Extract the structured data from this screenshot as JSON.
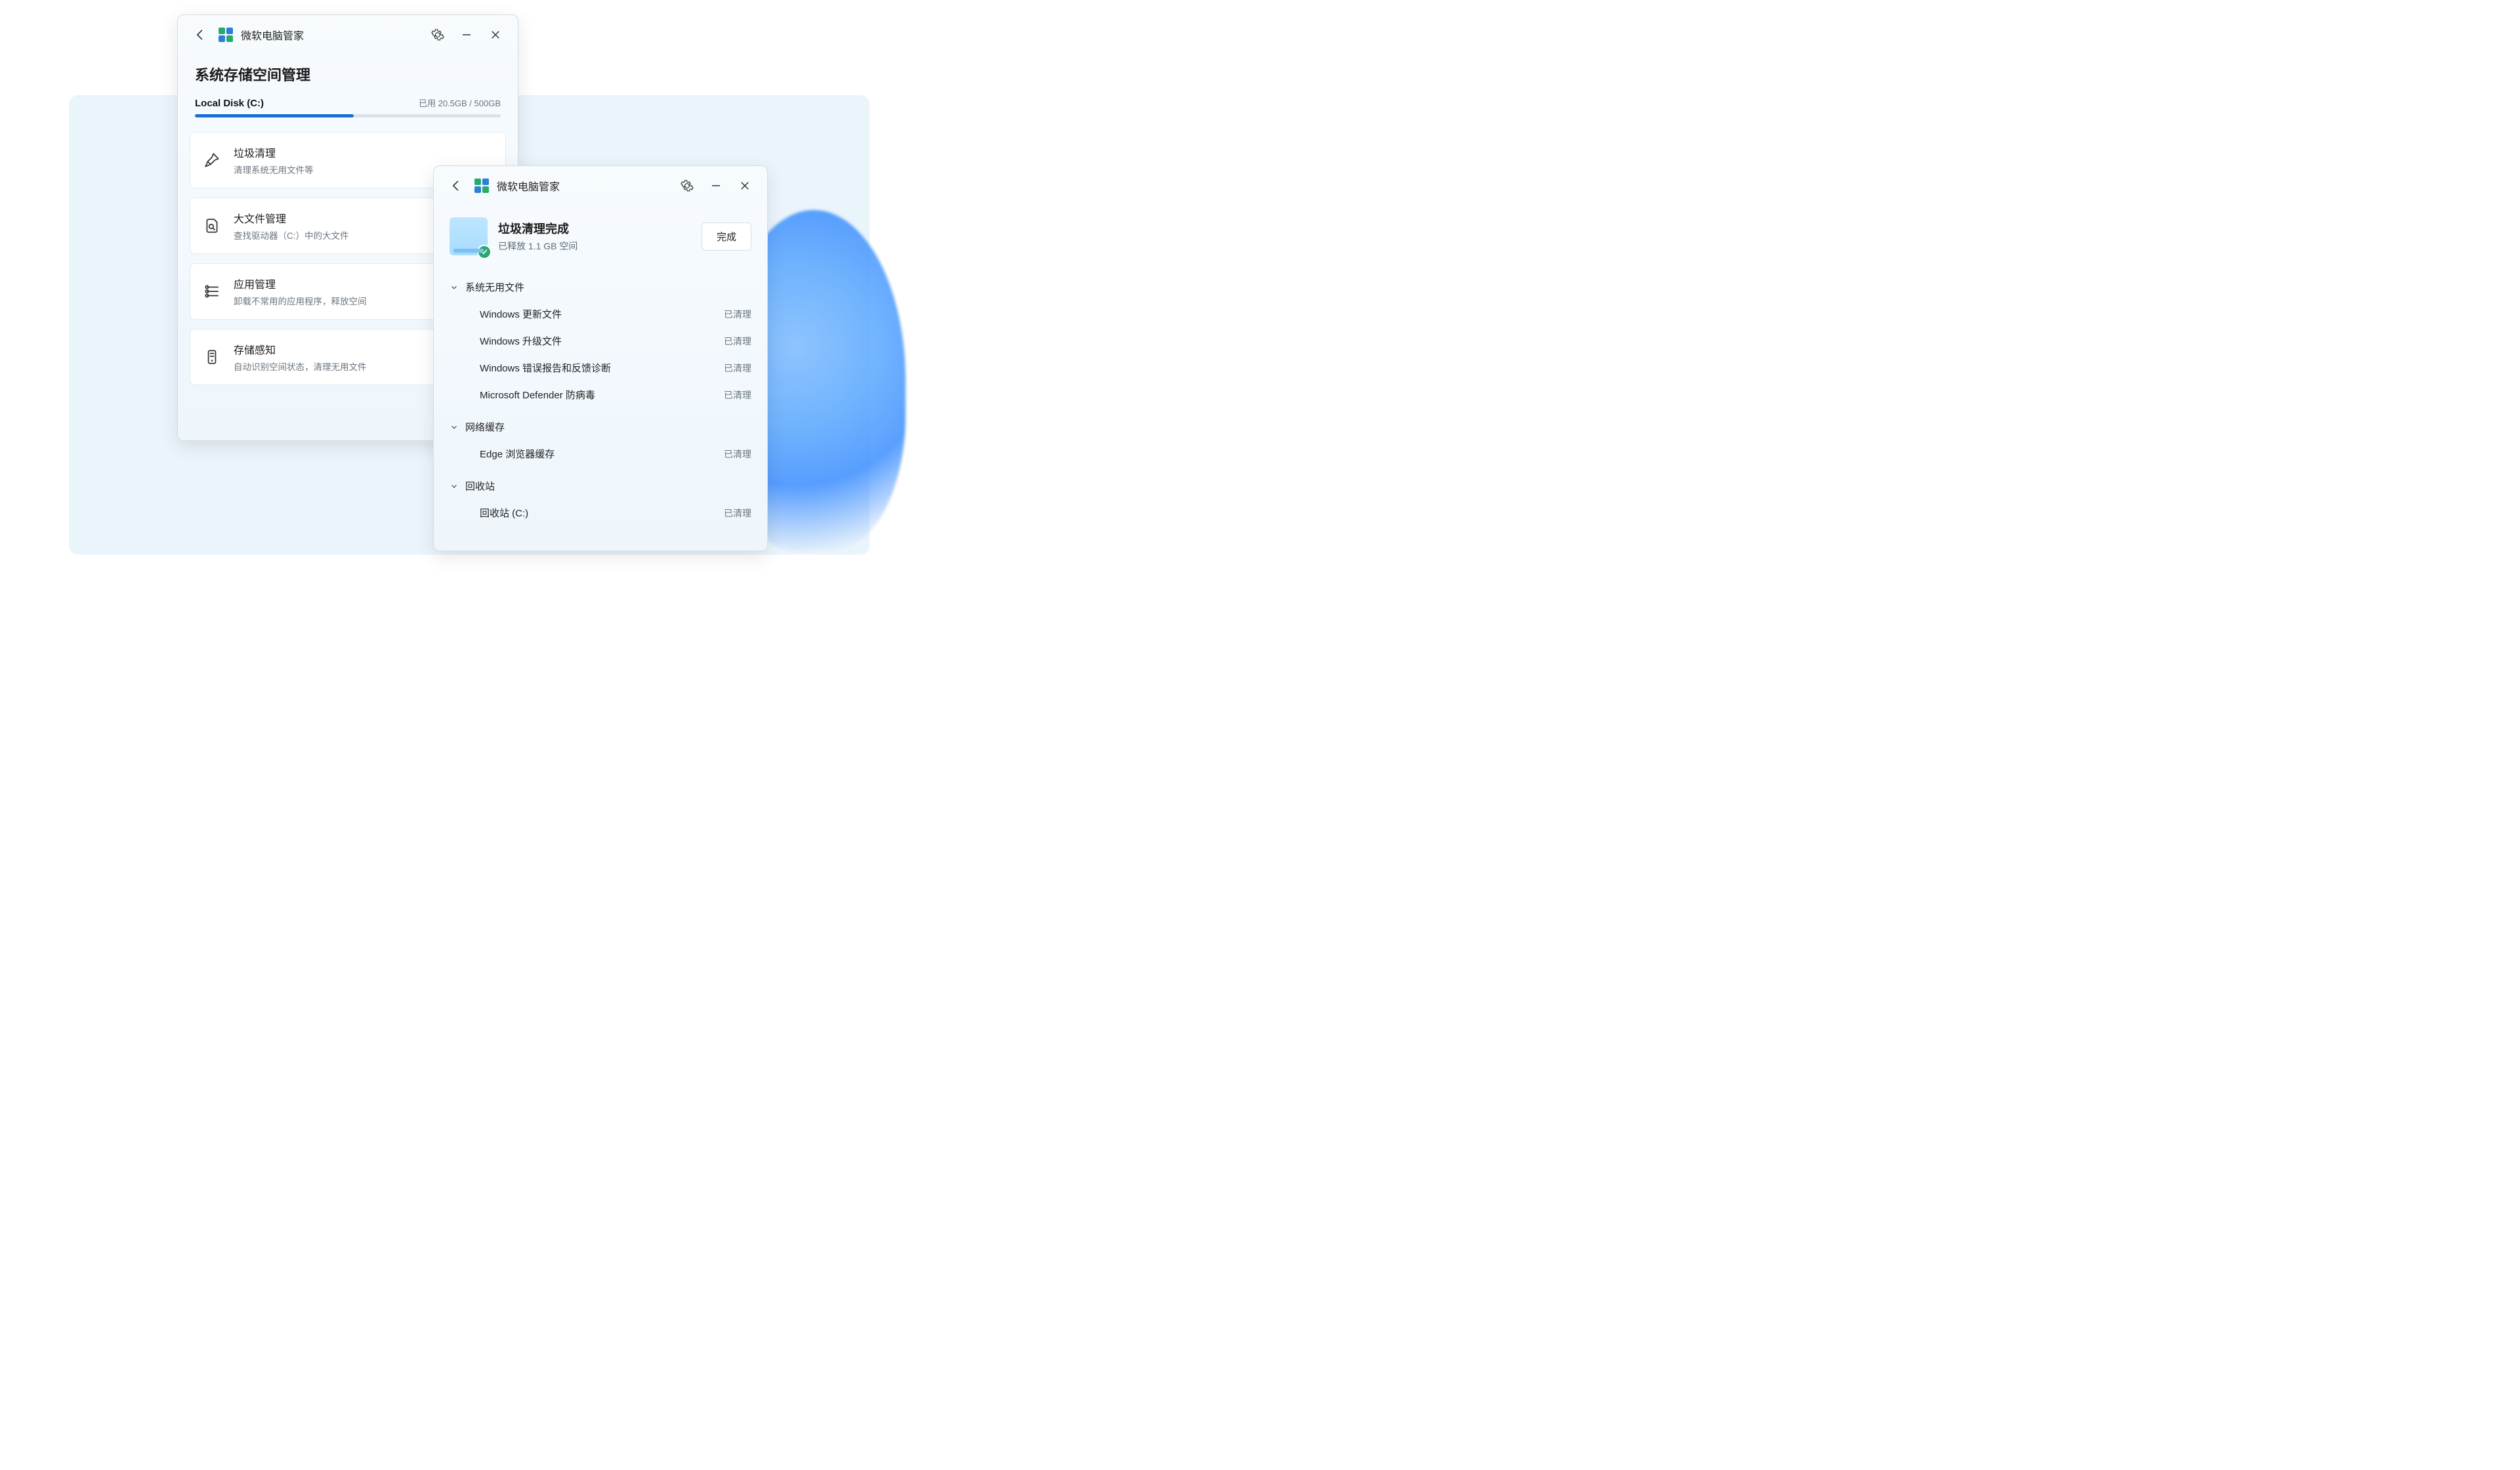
{
  "app_title": "微软电脑管家",
  "windowA": {
    "page_title": "系统存储空间管理",
    "disk_name": "Local Disk (C:)",
    "disk_usage": "已用 20.5GB / 500GB",
    "cards": [
      {
        "title": "垃圾清理",
        "sub": "清理系统无用文件等"
      },
      {
        "title": "大文件管理",
        "sub": "查找驱动器（C:）中的大文件"
      },
      {
        "title": "应用管理",
        "sub": "卸载不常用的应用程序，释放空间"
      },
      {
        "title": "存储感知",
        "sub": "自动识别空间状态，清理无用文件"
      }
    ]
  },
  "windowB": {
    "result_title": "垃圾清理完成",
    "result_sub": "已释放 1.1 GB 空间",
    "done_label": "完成",
    "status_cleaned": "已清理",
    "groups": [
      {
        "name": "系统无用文件",
        "items": [
          "Windows 更新文件",
          "Windows 升级文件",
          "Windows 错误报告和反馈诊断",
          "Microsoft Defender 防病毒"
        ]
      },
      {
        "name": "网络缓存",
        "items": [
          "Edge 浏览器缓存"
        ]
      },
      {
        "name": "回收站",
        "items": [
          "回收站 (C:)"
        ]
      }
    ]
  }
}
